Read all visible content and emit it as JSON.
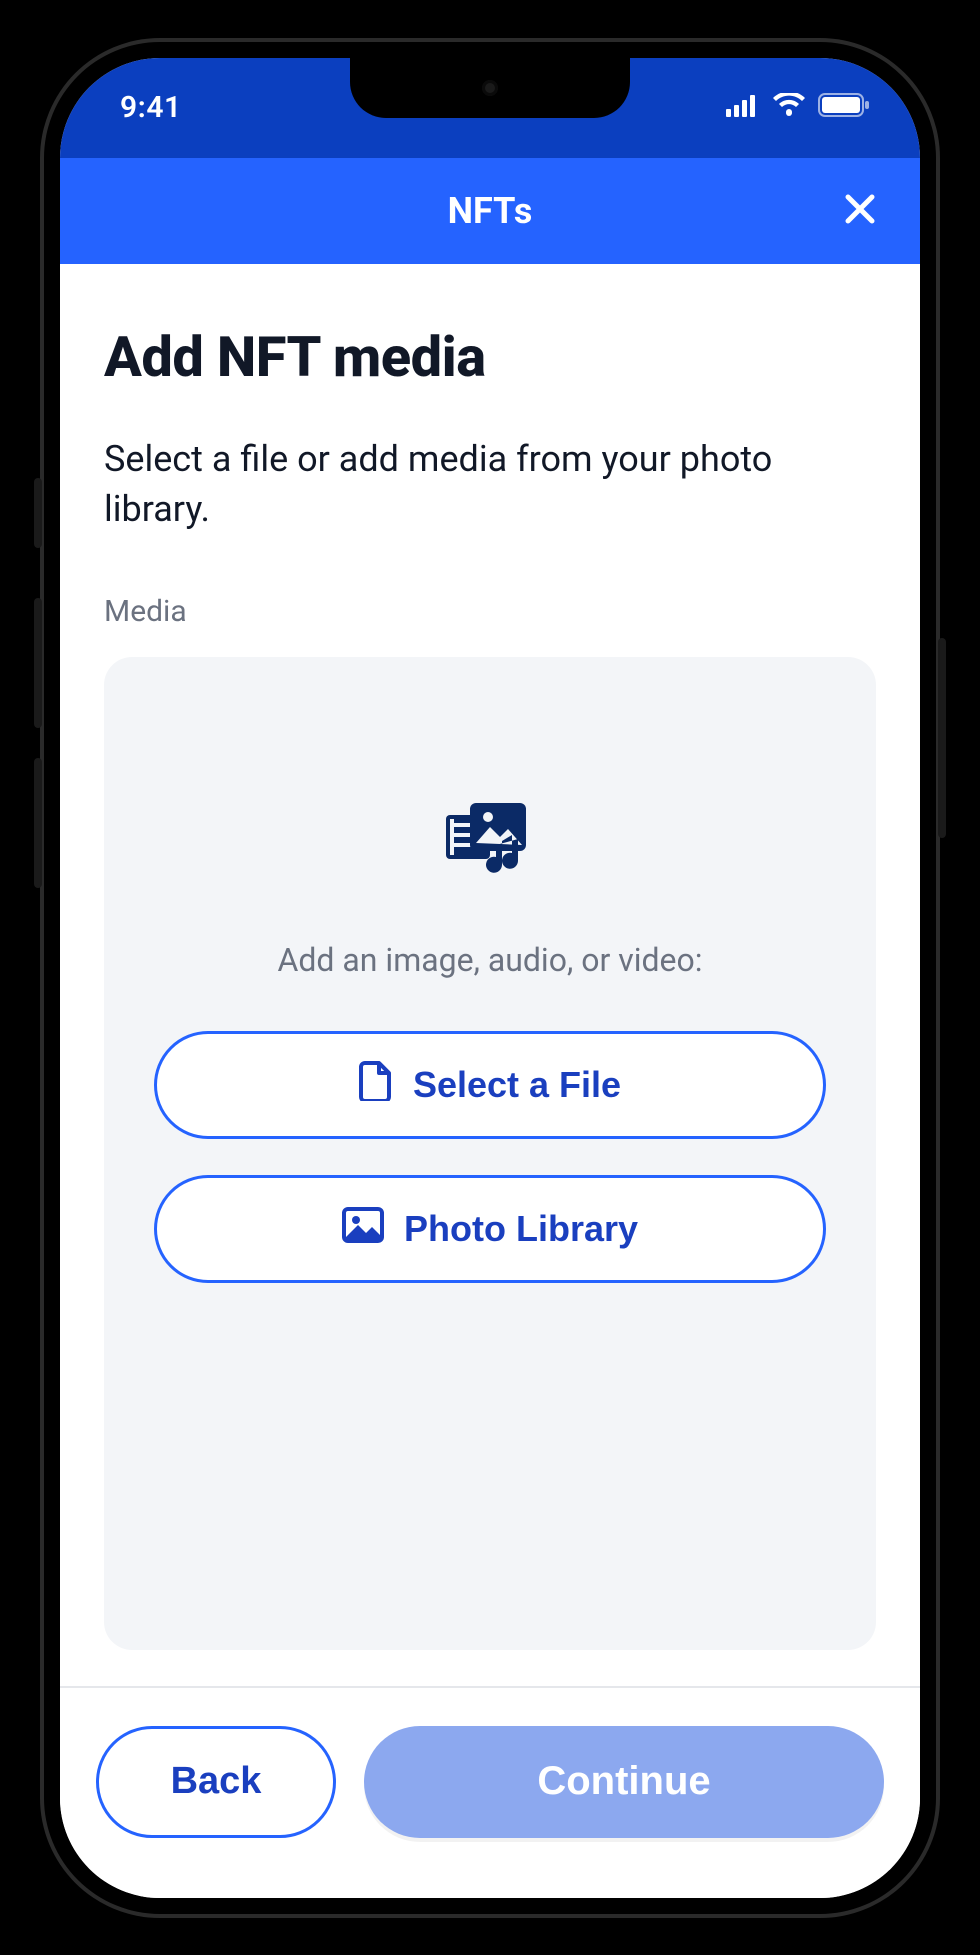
{
  "status": {
    "time": "9:41"
  },
  "nav": {
    "title": "NFTs"
  },
  "page": {
    "title": "Add NFT media",
    "subtitle": "Select a file or add media from your photo library."
  },
  "section": {
    "label": "Media"
  },
  "media": {
    "prompt": "Add an image, audio, or video:",
    "select_file_label": "Select a File",
    "photo_library_label": "Photo Library"
  },
  "footer": {
    "back_label": "Back",
    "continue_label": "Continue"
  },
  "colors": {
    "primary": "#2563ff",
    "primary_dark": "#0b3fbf",
    "disabled": "#8ca8ef",
    "text": "#111827",
    "muted": "#6b7280",
    "card_bg": "#f3f5f8"
  }
}
